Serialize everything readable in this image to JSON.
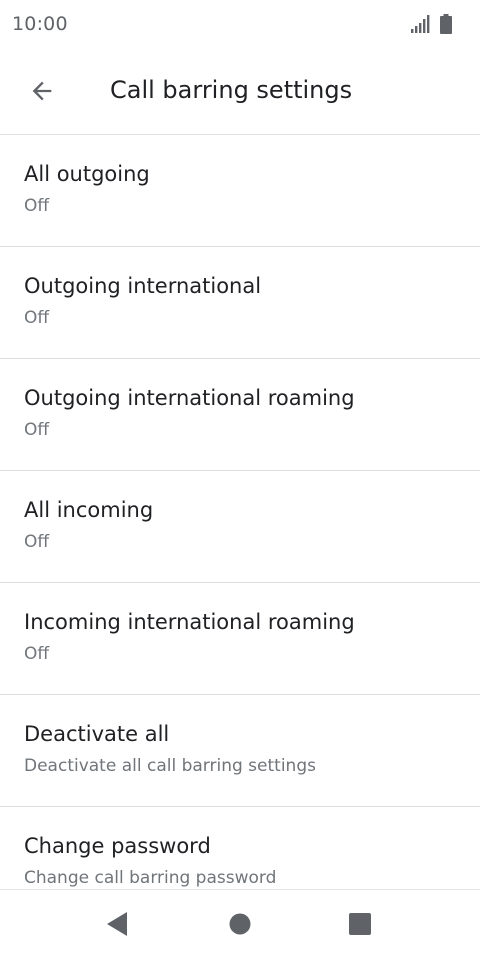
{
  "status_bar": {
    "time": "10:00",
    "icons": [
      "signal-icon",
      "battery-icon"
    ]
  },
  "app_bar": {
    "back_icon": "arrow-back-icon",
    "title": "Call barring settings"
  },
  "settings": {
    "items": [
      {
        "title": "All outgoing",
        "summary": "Off"
      },
      {
        "title": "Outgoing international",
        "summary": "Off"
      },
      {
        "title": "Outgoing international roaming",
        "summary": "Off"
      },
      {
        "title": "All incoming",
        "summary": "Off"
      },
      {
        "title": "Incoming international roaming",
        "summary": "Off"
      },
      {
        "title": "Deactivate all",
        "summary": "Deactivate all call barring settings"
      },
      {
        "title": "Change password",
        "summary": "Change call barring password"
      }
    ]
  },
  "nav_bar": {
    "icons": [
      "nav-back-icon",
      "nav-home-icon",
      "nav-recents-icon"
    ]
  },
  "colors": {
    "text_primary": "#202124",
    "text_secondary": "#70757a",
    "divider": "#dadce0",
    "icon": "#5f6368"
  }
}
